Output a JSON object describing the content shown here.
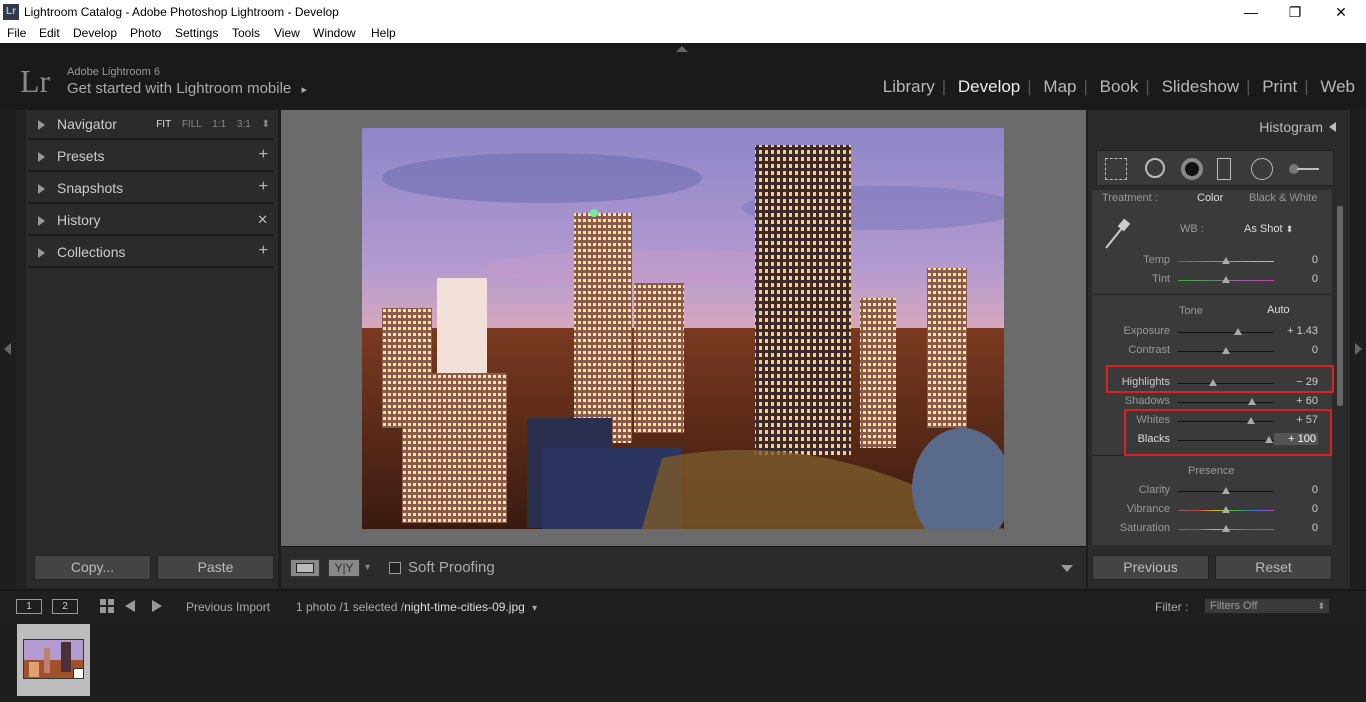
{
  "window": {
    "app_icon": "Lr",
    "title": "Lightroom Catalog - Adobe Photoshop Lightroom - Develop",
    "minimize": "—",
    "maximize": "❐",
    "close": "✕"
  },
  "menu": [
    "File",
    "Edit",
    "Develop",
    "Photo",
    "Settings",
    "Tools",
    "View",
    "Window",
    "Help"
  ],
  "identity": {
    "logo": "Lr",
    "product": "Adobe Lightroom 6",
    "mobile_prompt": "Get started with Lightroom mobile",
    "mobile_arrow": "▸"
  },
  "modules": [
    {
      "label": "Library",
      "active": false
    },
    {
      "label": "Develop",
      "active": true
    },
    {
      "label": "Map",
      "active": false
    },
    {
      "label": "Book",
      "active": false
    },
    {
      "label": "Slideshow",
      "active": false
    },
    {
      "label": "Print",
      "active": false
    },
    {
      "label": "Web",
      "active": false
    }
  ],
  "module_separator": "|",
  "left_panel": {
    "navigator": {
      "label": "Navigator",
      "zoom_options": [
        "FIT",
        "FILL",
        "1:1",
        "3:1"
      ],
      "zoom_active": "FIT",
      "zoom_menu": "⬍"
    },
    "sections": [
      {
        "label": "Presets",
        "control": "+"
      },
      {
        "label": "Snapshots",
        "control": "+"
      },
      {
        "label": "History",
        "control": "✕"
      },
      {
        "label": "Collections",
        "control": "+"
      }
    ],
    "copy_button": "Copy...",
    "paste_button": "Paste"
  },
  "toolbar": {
    "soft_proofing_label": "Soft Proofing",
    "yy_label": "Y|Y",
    "view_menu": "▾"
  },
  "right_panel": {
    "histogram_label": "Histogram",
    "treatment_label": "Treatment :",
    "treatment_color": "Color",
    "treatment_bw": "Black & White",
    "wb_label": "WB :",
    "wb_value": "As Shot",
    "wb_arrows": "⬍",
    "tone_label": "Tone",
    "auto_label": "Auto",
    "presence_label": "Presence",
    "sliders": [
      {
        "name": "Temp",
        "value": "0",
        "position": 0.5
      },
      {
        "name": "Tint",
        "value": "0",
        "position": 0.5
      },
      {
        "name": "Exposure",
        "value": "+ 1.43",
        "position": 0.63
      },
      {
        "name": "Contrast",
        "value": "0",
        "position": 0.5
      },
      {
        "name": "Highlights",
        "value": "− 29",
        "position": 0.36
      },
      {
        "name": "Shadows",
        "value": "+ 60",
        "position": 0.77
      },
      {
        "name": "Whites",
        "value": "+ 57",
        "position": 0.76
      },
      {
        "name": "Blacks",
        "value": "+ 100",
        "position": 0.95
      },
      {
        "name": "Clarity",
        "value": "0",
        "position": 0.5
      },
      {
        "name": "Vibrance",
        "value": "0",
        "position": 0.5
      },
      {
        "name": "Saturation",
        "value": "0",
        "position": 0.5
      }
    ],
    "previous_button": "Previous",
    "reset_button": "Reset"
  },
  "filmstrip_bar": {
    "screen1": "1",
    "screen2": "2",
    "source": "Previous Import",
    "selection": "1 photo /1 selected /",
    "filename": "night-time-cities-09.jpg",
    "filename_menu": "▾",
    "filter_label": "Filter :",
    "filter_value": "Filters Off",
    "filter_arrows": "⬍"
  },
  "colors": {
    "highlight_box": "#e02020",
    "panel_bg": "#2b2b2b",
    "center_bg": "#6b6b6b"
  }
}
